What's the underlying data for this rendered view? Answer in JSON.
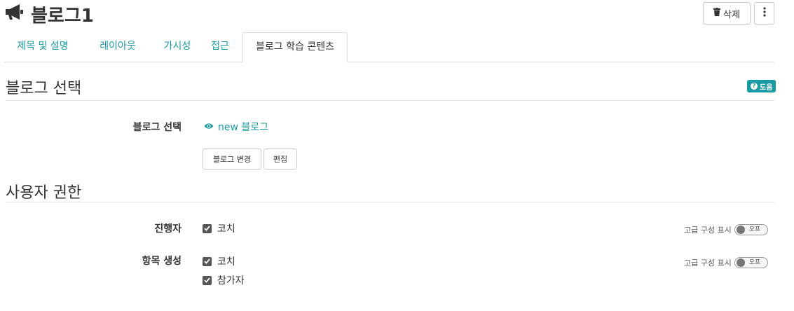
{
  "header": {
    "title": "블로그1",
    "delete_label": "삭제",
    "more_icon": "vertical-ellipsis-icon"
  },
  "tabs": [
    {
      "label": "제목 및 설명"
    },
    {
      "label": "레이아웃"
    },
    {
      "label": "가시성"
    },
    {
      "label": "접근"
    },
    {
      "label": "블로그 학습 콘텐츠",
      "active": true
    }
  ],
  "blog_section": {
    "title": "블로그 선택",
    "help_label": "도움",
    "field_label": "블로그 선택",
    "selected_blog": "new 블로그",
    "change_button": "블로그 변경",
    "edit_button": "편집"
  },
  "permissions_section": {
    "title": "사용자 권한",
    "rows": [
      {
        "label": "진행자",
        "options": [
          {
            "label": "코치",
            "checked": true
          }
        ],
        "advanced_label": "고급 구성 표시",
        "toggle_label": "오프"
      },
      {
        "label": "항목 생성",
        "options": [
          {
            "label": "코치",
            "checked": true
          },
          {
            "label": "참가자",
            "checked": true
          }
        ],
        "advanced_label": "고급 구성 표시",
        "toggle_label": "오프"
      }
    ]
  },
  "colors": {
    "accent": "#1a9aa3",
    "text": "#333333",
    "border": "#dddddd"
  }
}
